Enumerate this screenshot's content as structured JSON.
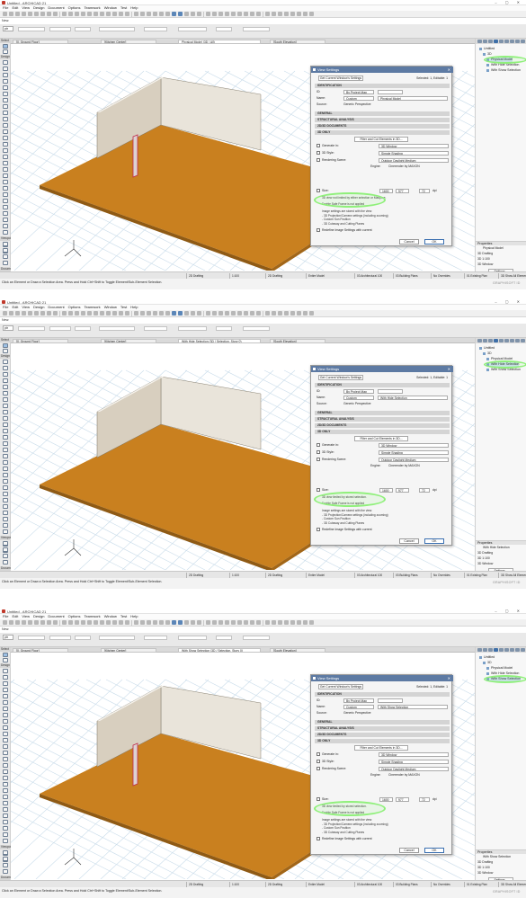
{
  "app": {
    "title": "Untitled - ARCHICAD 21",
    "window_controls": "– ▢ ✕",
    "menu": [
      "File",
      "Edit",
      "View",
      "Design",
      "Document",
      "Options",
      "Teamwork",
      "Window",
      "Test",
      "Help"
    ],
    "new_label": "New:",
    "info_select": "ptr"
  },
  "toolbox": {
    "select_label": "Select",
    "design_label": "Design",
    "viewpoint_label": "Viewpoint",
    "document_label": "Document"
  },
  "status": {
    "items": [
      "2D Drafting",
      "1:100",
      "2D Drafting",
      "Entire Model",
      "03 Architectural 100",
      "03 Building Plans",
      "No Overrides",
      "01 Existing Plan",
      "3D Show All Elements",
      "Simple Shading"
    ],
    "hint": "Click an Element or Draw a Selection Area. Press and Hold Ctrl+Shift to Toggle Element/Sub-Element Selection."
  },
  "navigator": {
    "project": "Untitled",
    "folder": "3D",
    "properties_label": "Properties",
    "settings_button": "Settings...",
    "brand": "GRAPHISOFT ID"
  },
  "dialog": {
    "title": "View Settings",
    "close": "✕",
    "get_current": "Get Current Window's Settings",
    "identification": "IDENTIFICATION",
    "id_label": "ID:",
    "id_value": "By Project Map",
    "name_label": "Name:",
    "name_mode": "Custom",
    "source_label": "Source:",
    "source_value": "Generic Perspective",
    "general": "GENERAL",
    "structural": "STRUCTURAL ANALYSIS",
    "docs": "2D/3D DOCUMENTS",
    "only3d": "3D ONLY",
    "filter_btn": "Filter and Cut Elements in 3D...",
    "generate_label": "Generate in:",
    "generate_value": "3D Window",
    "style_label": "3D Style:",
    "style_value": "Simple Shading",
    "scene_label": "Rendering Scene:",
    "scene_value": "Outdoor Daylight Medium",
    "engine_label": "Engine:",
    "engine_value": "Cinerender by MAXON",
    "size_label": "Size:",
    "size_w": "1600",
    "size_h": "977",
    "size_dpi": "72",
    "size_unit": "dpi",
    "safe_frame": "Enable Safe Frame is not applied",
    "notes": [
      "Image settings are stored with the view:",
      "- 3D Projection/Camera settings (including zooming)",
      "- Custom Sun Position",
      "- 3D Cutaway and Cutting Planes"
    ],
    "redefine": "Redefine Image Settings with current",
    "cancel": "Cancel",
    "ok": "OK"
  },
  "panels": [
    {
      "tabs": [
        "[0. Ground Floor]",
        "[Kitchen Center]",
        "Physical Model (3D / All)",
        "[South Elevation]"
      ],
      "active_tab": 2,
      "tree": [
        "Physical Model",
        "With Hide Selection",
        "With Show Selection"
      ],
      "selected_tree": 0,
      "dialog_selected": "Selected: 1, Editable: 1",
      "dialog_name": "Physical Model",
      "status_msg": "3D view not limited by either selection or Marquee.",
      "props": [
        "Physical Model",
        "3D Drafting",
        "3D 1:100",
        "3D Window"
      ],
      "show_column": true
    },
    {
      "tabs": [
        "[0. Ground Floor]",
        "[Kitchen Center]",
        "With Hide Selection (3D / Selection, Story 0)",
        "[South Elevation]"
      ],
      "active_tab": 2,
      "tree": [
        "Physical Model",
        "With Hide Selection",
        "With Show Selection"
      ],
      "selected_tree": 1,
      "dialog_selected": "Selected: 1, Editable: 1",
      "dialog_name": "With Hide Selection",
      "status_msg": "3D view limited by stored selection.",
      "props": [
        "With Hide Selection",
        "3D Drafting",
        "3D 1:100",
        "3D Window"
      ],
      "show_column": false
    },
    {
      "tabs": [
        "[0. Ground Floor]",
        "[Kitchen Center]",
        "With Show Selection (3D / Selection, Story 0)",
        "[South Elevation]"
      ],
      "active_tab": 2,
      "tree": [
        "Physical Model",
        "With Hide Selection",
        "With Show Selection"
      ],
      "selected_tree": 2,
      "dialog_selected": "Selected: 1, Editable: 1",
      "dialog_name": "With Show Selection",
      "status_msg": "3D view limited by stored selection.",
      "props": [
        "With Show Selection",
        "3D Drafting",
        "3D 1:100",
        "3D Window"
      ],
      "show_column": true
    }
  ],
  "colors": {
    "floor": "#c9801f",
    "wall": "#d8cfbf",
    "grid": "#c9dcea",
    "highlight": "#8ff07a",
    "accent": "#5d7aa3"
  }
}
